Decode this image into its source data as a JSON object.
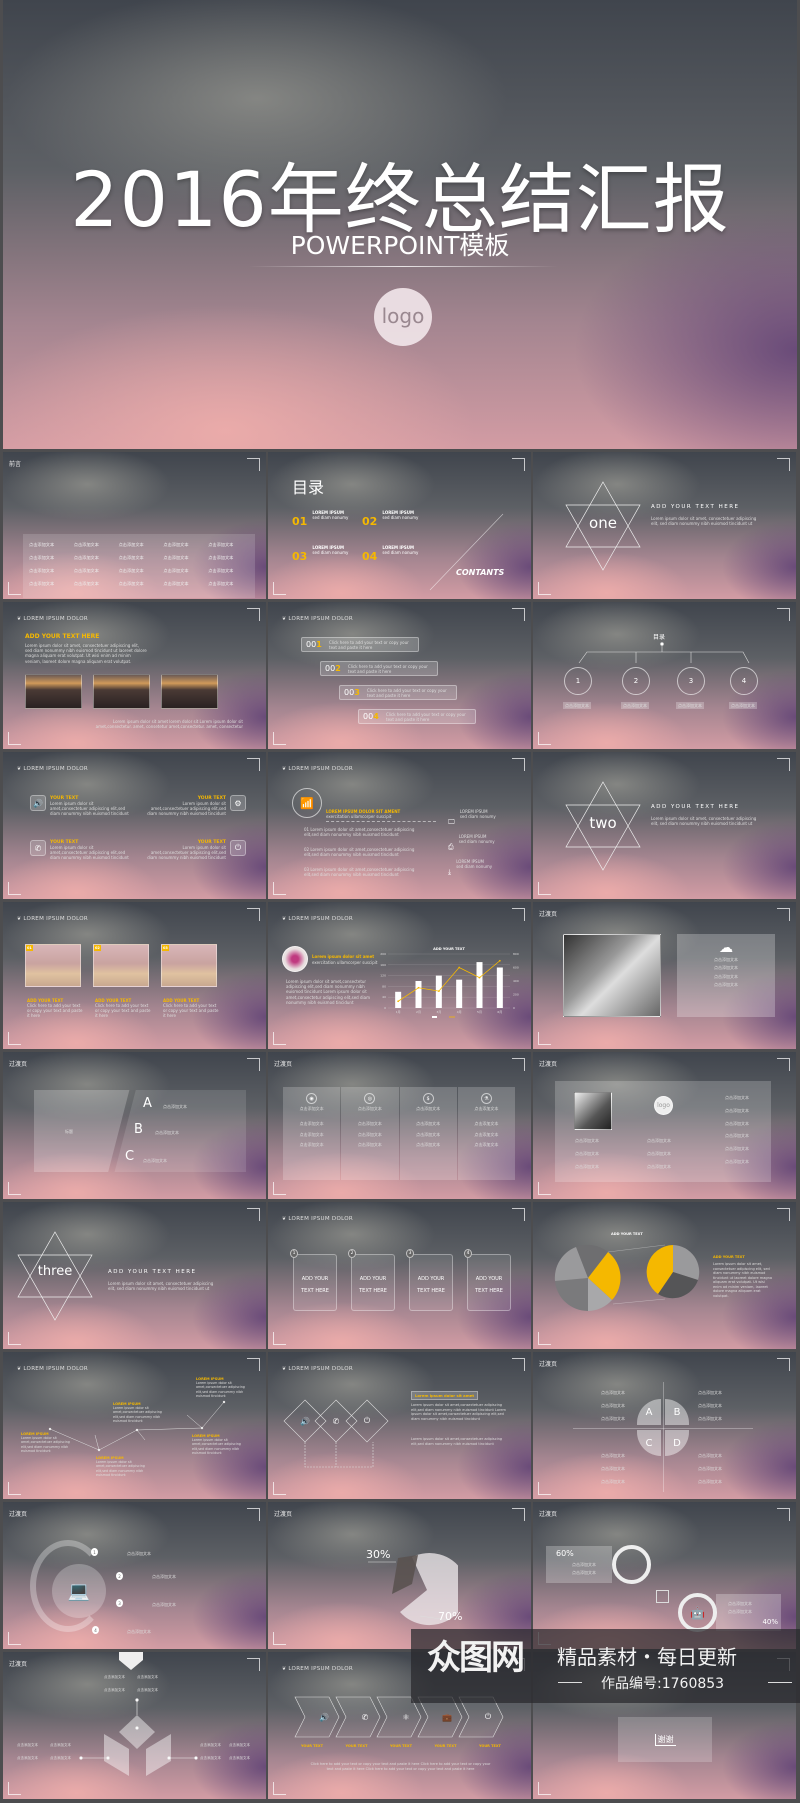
{
  "hero": {
    "title": "2016年终总结汇报",
    "subtitle": "POWERPOINT模板",
    "logo": "logo"
  },
  "common": {
    "add": "点击添加文本",
    "lorem_dolor": "LOREM IPSUM DOLOR",
    "transition": "过渡页",
    "add_your_text_here": "ADD YOUR TEXT HERE",
    "lorem_line": "Lorem ipsum dolor sit amet, consectetuer adipiscing elit, sed diam nonummy nibh euismod tincidunt ut",
    "your_text": "YOUR TEXT",
    "add_your_text": "ADD YOUR TEXT",
    "click_here": "Click here to add your text or copy your text and paste it here",
    "lorem_ipsum": "LOREM IPSUM",
    "sed_diam": "sed diam nonumy",
    "lorem_short": "Lorem ipsum dolor sit amet,consectetuer adipiscing elit,sed diam nonummy nibh euismod tincidunt"
  },
  "s1": {
    "header": "前言",
    "cells": [
      "点击添加文本",
      "点击添加文本",
      "点击添加文本",
      "点击添加文本",
      "点击添加文本",
      "点击添加文本",
      "点击添加文本",
      "点击添加文本",
      "点击添加文本",
      "点击添加文本",
      "点击添加文本",
      "点击添加文本",
      "点击添加文本",
      "点击添加文本",
      "点击添加文本",
      "点击添加文本",
      "点击添加文本",
      "点击添加文本",
      "点击添加文本",
      "点击添加文本"
    ]
  },
  "s2": {
    "title": "目录",
    "items": [
      {
        "num": "01",
        "label": "LOREM IPSUM",
        "sub": "sed diam nonumy"
      },
      {
        "num": "02",
        "label": "LOREM IPSUM",
        "sub": "sed diam nonumy"
      },
      {
        "num": "03",
        "label": "LOREM IPSUM",
        "sub": "sed diam nonumy"
      },
      {
        "num": "04",
        "label": "LOREM IPSUM",
        "sub": "sed diam nonumy"
      }
    ],
    "contents": "CONTANTS"
  },
  "s3": {
    "word": "one"
  },
  "s4": {
    "body": "Lorem ipsum dolor sit amet, consectetuer adipiscing elit, sed diam nonummy nibh euismod tincidunt ut laoreet dolore magna aliquam erat volutpat. Ut wisi enim ad minim veniam, laoreet dolore magna aliquam erat volutpat.",
    "caption": "Lorem ipsum dolor sit amet lorem dolor sit Lorem ipsum dolor sit amet,consectetur. amet, consetetur amet,consectetur. amet, consectetur"
  },
  "s5": {
    "items": [
      {
        "num": "00",
        "hl": "1"
      },
      {
        "num": "00",
        "hl": "2"
      },
      {
        "num": "00",
        "hl": "3"
      },
      {
        "num": "00",
        "hl": "4"
      }
    ]
  },
  "s6": {
    "title": "目录",
    "nums": [
      "1",
      "2",
      "3",
      "4"
    ]
  },
  "s7": {
    "icons": [
      "speaker-icon",
      "gear-icon",
      "phone-icon",
      "plug-icon"
    ]
  },
  "s8": {
    "title": "LOREM IPSUM DOLOR SIT AMENT",
    "subtitle": "exercitation ullamcorper suscipit",
    "list": [
      "01",
      "02",
      "03"
    ]
  },
  "s9": {
    "word": "two"
  },
  "s10": {
    "nums": [
      "01",
      "02",
      "03"
    ],
    "caption": "Click here to add your text or copy your text and paste it here"
  },
  "s11": {
    "heading": "Lorem ipsum dolor sit amet",
    "subheading": "exercitation ullamcorper suscipit",
    "body": "Lorem ipsum dolor sit amet,consectetur adipiscing elit,sed diam nonummy nibh euismod tincidunt Lorem ipsum dolor sit amet,consectetur adipiscing elit,sed diam nonummy nibh euismod tincidunt"
  },
  "chart_data": {
    "type": "bar",
    "title": "ADD YOUR TEXT",
    "categories": [
      "1月",
      "2月",
      "3月",
      "4月",
      "5月",
      "6月"
    ],
    "series": [
      {
        "type": "bar",
        "values": [
          60,
          100,
          120,
          105,
          170,
          150
        ]
      },
      {
        "type": "line",
        "axis": "right",
        "values": [
          100,
          300,
          250,
          600,
          450,
          700
        ]
      }
    ],
    "ylim": [
      0,
      200
    ],
    "yticks": [
      0,
      40,
      80,
      120,
      160,
      200
    ],
    "y2lim": [
      0,
      800
    ],
    "y2ticks": [
      0,
      200,
      400,
      600,
      800
    ],
    "colors": {
      "bar": "#ffffff",
      "line": "#f5b800"
    },
    "grid": true,
    "legend": "bottom"
  },
  "s13": {
    "caption": "标题",
    "letters": [
      "A",
      "B",
      "C"
    ]
  },
  "s14": {
    "icons": [
      "chat-icon",
      "target-icon",
      "money-icon",
      "flask-icon"
    ]
  },
  "s15": {
    "logo": "logo"
  },
  "s16": {
    "word": "three"
  },
  "s17": {
    "nums": [
      "1",
      "2",
      "3",
      "4"
    ],
    "line1": "ADD YOUR",
    "line2": "TEXT HERE"
  },
  "s18": {
    "title": "ADD YOUR TEXT",
    "colors": {
      "highlight": "#f5b800",
      "dark": "#5a5a5c",
      "mid": "#8c8c8e",
      "light": "#b4b4b6"
    }
  },
  "s19": {
    "labels": [
      "LOREM IPSUM",
      "LOREM IPSUM",
      "LOREM IPSUM",
      "LOREM IPSUM",
      "LOREM IPSUM"
    ]
  },
  "s20": {
    "heading": "Lorem ipsum dolor sit amet"
  },
  "s21": {
    "letters": [
      "A",
      "B",
      "C",
      "D"
    ]
  },
  "s22": {
    "nums": [
      "1",
      "2",
      "3",
      "4"
    ]
  },
  "s23": {
    "small": "30%",
    "large": "70%"
  },
  "s24": {
    "left": "60%",
    "right": "40%"
  },
  "s27": {
    "thanks": "谢谢"
  },
  "watermark": {
    "brand": "众图网",
    "slogan": "精品素材・每日更新",
    "code": "作品编号:1760853"
  },
  "accent": "#f5b800"
}
